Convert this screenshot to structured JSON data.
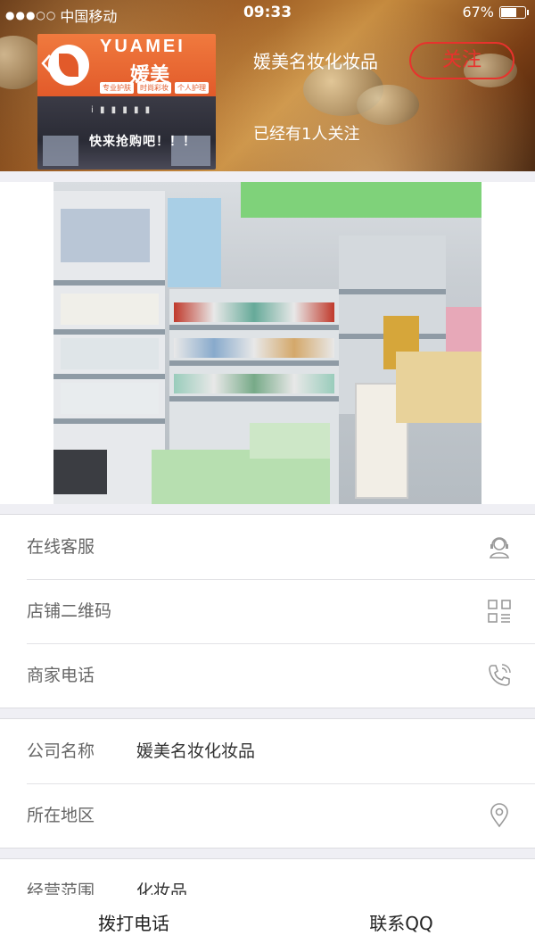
{
  "status_bar": {
    "carrier": "中国移动",
    "time": "09:33",
    "battery": "67%",
    "battery_level": 0.67
  },
  "header": {
    "back_icon": "chevron-left-icon",
    "logo": {
      "brand": "YUAMEI",
      "name_cn": "媛美",
      "tags": [
        "专业护肤",
        "时尚彩妆",
        "个人护理"
      ],
      "slogan": "快来抢购吧！！！"
    },
    "shop_name": "媛美名妆化妆品",
    "follow_label": "关注",
    "follow_count_text": "已经有1人关注"
  },
  "accent_color": "#e8322d",
  "service_group": [
    {
      "label": "在线客服",
      "icon": "customer-service-icon"
    },
    {
      "label": "店铺二维码",
      "icon": "qr-code-icon"
    },
    {
      "label": "商家电话",
      "icon": "phone-icon"
    }
  ],
  "info_group": [
    {
      "label": "公司名称",
      "value": "媛美名妆化妆品"
    },
    {
      "label": "所在地区",
      "value": "",
      "icon": "location-pin-icon"
    }
  ],
  "scope_group": [
    {
      "label": "经营范围",
      "value": "化妆品"
    }
  ],
  "bottom_bar": {
    "call_label": "拨打电话",
    "qq_label": "联系QQ"
  }
}
